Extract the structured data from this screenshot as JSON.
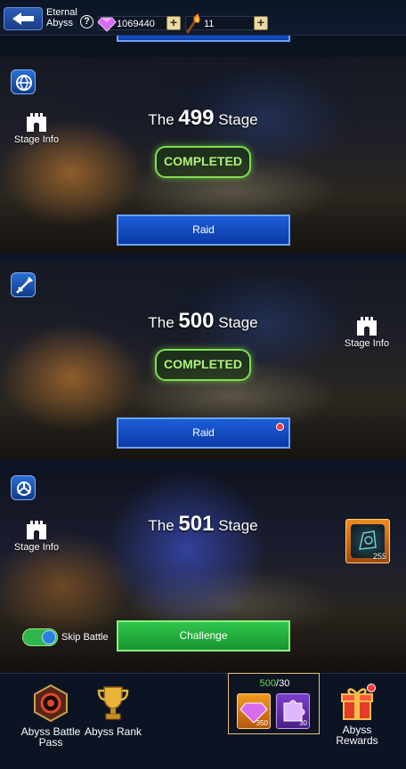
{
  "header": {
    "title_line1": "Eternal",
    "title_line2": "Abyss",
    "help_symbol": "?",
    "gems_value": "1069440",
    "fire_value": "11",
    "plus": "+"
  },
  "stages": [
    {
      "title_prefix": "The",
      "number": "499",
      "title_suffix": "Stage",
      "status": "COMPLETED",
      "info_label": "Stage Info",
      "action_label": "Raid",
      "badge_icon": "globe-icon"
    },
    {
      "title_prefix": "The",
      "number": "500",
      "title_suffix": "Stage",
      "status": "COMPLETED",
      "info_label": "Stage Info",
      "action_label": "Raid",
      "badge_icon": "sword-icon",
      "has_notification": true
    },
    {
      "title_prefix": "The",
      "number": "501",
      "title_suffix": "Stage",
      "info_label": "Stage Info",
      "action_label": "Challenge",
      "badge_icon": "helm-icon",
      "reward_qty": "255"
    }
  ],
  "skip_battle": {
    "label": "Skip Battle",
    "enabled": true
  },
  "bottom": {
    "battle_pass": "Abyss Battle Pass",
    "battle_pass_line1": "Abyss Battle",
    "battle_pass_line2": "Pass",
    "rank": "Abyss Rank",
    "chest_progress_current": "500",
    "chest_progress_total": "/30",
    "chest_qty_a": "350",
    "chest_qty_b": "30",
    "rewards_line1": "Abyss",
    "rewards_line2": "Rewards"
  },
  "colors": {
    "accent_blue": "#1d5ed8",
    "completed_green": "#7fe04c",
    "challenge_green": "#2fc64c",
    "notification_red": "#ff3b3b"
  }
}
